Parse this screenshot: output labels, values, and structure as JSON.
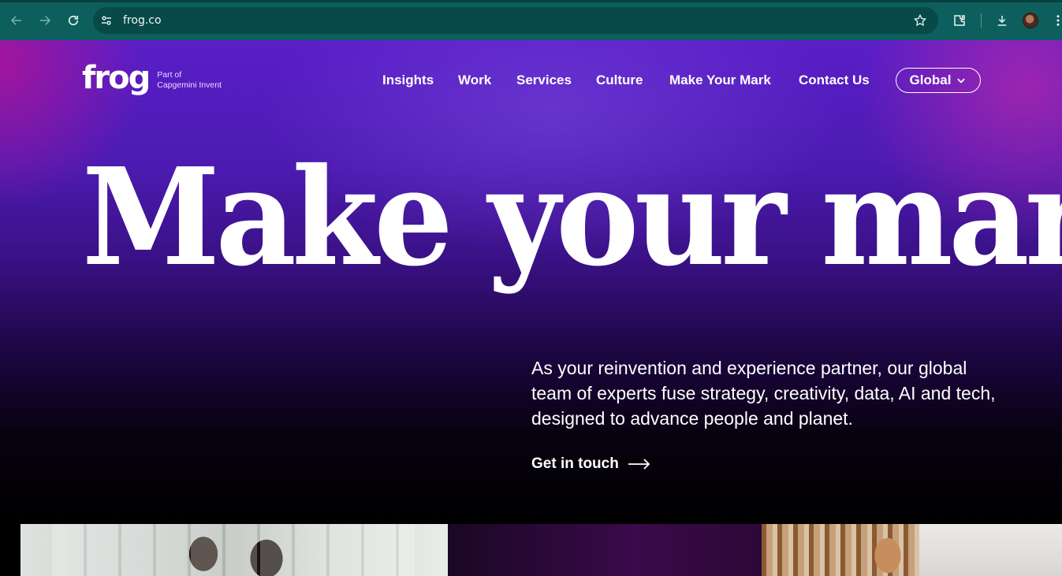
{
  "browser": {
    "url": "frog.co",
    "icons": [
      "back-arrow-icon",
      "forward-arrow-icon",
      "reload-icon",
      "site-settings-icon",
      "bookmark-star-icon",
      "extensions-icon",
      "download-icon",
      "profile-avatar",
      "more-menu-icon"
    ]
  },
  "site": {
    "logo_word": "frog",
    "logo_sub_line1": "Part of",
    "logo_sub_line2": "Capgemini Invent",
    "nav": [
      "Insights",
      "Work",
      "Services",
      "Culture",
      "Make Your Mark",
      "Contact Us"
    ],
    "region_label": "Global",
    "headline": "Make your mark",
    "intro": "As your reinvention and experience partner, our global team of experts fuse strategy, creativity, data, AI and tech, designed to advance people and planet.",
    "cta_label": "Get in touch",
    "colors": {
      "chrome": "#0c5f5c",
      "omnibox": "#074a48",
      "hero_top": "#5a1ec8",
      "hero_bottom": "#000000",
      "text": "#ffffff"
    }
  }
}
